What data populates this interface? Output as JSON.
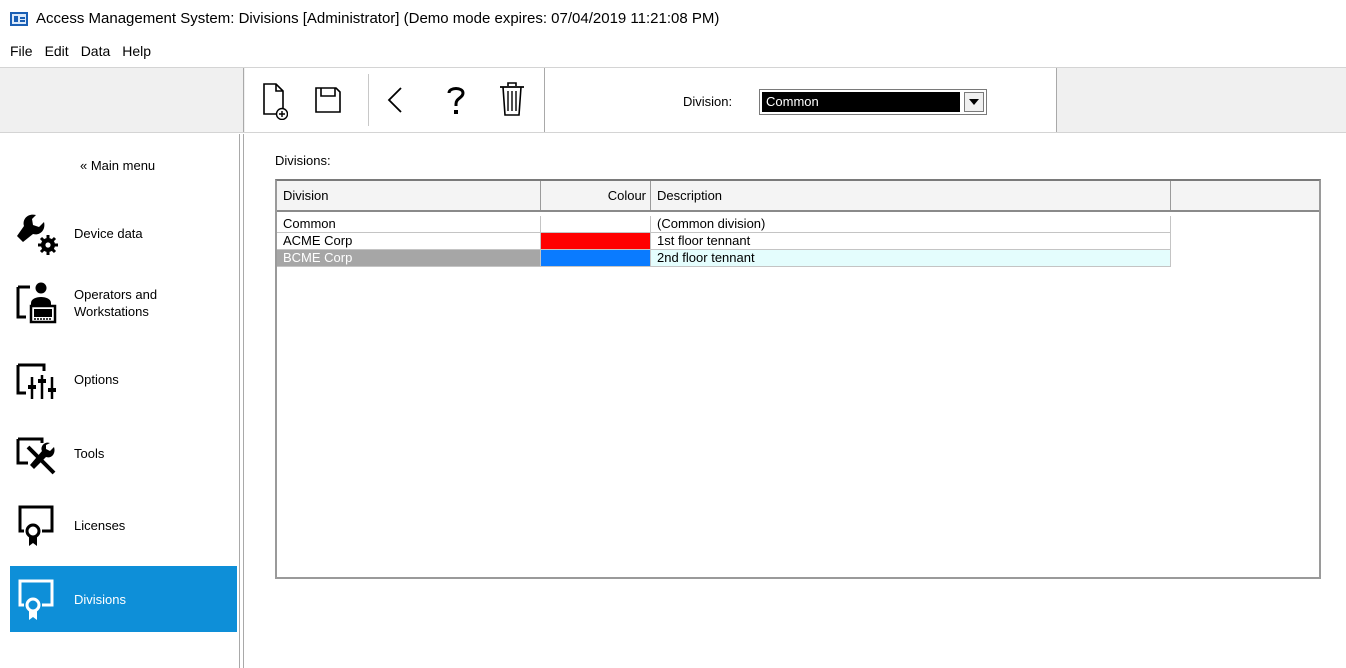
{
  "window": {
    "title": "Access Management System: Divisions [Administrator]  (Demo mode expires: 07/04/2019 11:21:08 PM)"
  },
  "menu": [
    "File",
    "Edit",
    "Data",
    "Help"
  ],
  "toolbar": {
    "buttons": [
      {
        "name": "new-record-icon"
      },
      {
        "name": "save-icon"
      },
      {
        "name": "back-icon"
      },
      {
        "name": "help-icon"
      },
      {
        "name": "delete-icon"
      }
    ],
    "division_label": "Division:",
    "division_value": "Common"
  },
  "sidebar": {
    "main_menu": "« Main menu",
    "items": [
      {
        "label": "Device data",
        "icon": "wrench-gear-icon",
        "active": false
      },
      {
        "label": "Operators and\nWorkstations",
        "icon": "operator-workstation-icon",
        "active": false
      },
      {
        "label": "Options",
        "icon": "sliders-icon",
        "active": false
      },
      {
        "label": "Tools",
        "icon": "tools-icon",
        "active": false
      },
      {
        "label": "Licenses",
        "icon": "license-certificate-icon",
        "active": false
      },
      {
        "label": "Divisions",
        "icon": "division-certificate-icon",
        "active": true
      }
    ]
  },
  "content": {
    "title": "Divisions:",
    "columns": [
      "Division",
      "Colour",
      "Description",
      ""
    ],
    "rows": [
      {
        "division": "Common",
        "colour": "",
        "description": "(Common division)",
        "selected": false
      },
      {
        "division": "ACME Corp",
        "colour": "#ff0000",
        "description": "1st floor tennant",
        "selected": false
      },
      {
        "division": "BCME Corp",
        "colour": "#0a7bff",
        "description": "2nd floor tennant",
        "selected": true
      }
    ]
  },
  "colors": {
    "accent": "#0e8fd8",
    "selected_row": "#a6a6a6",
    "selected_desc": "#e4fdfd"
  }
}
